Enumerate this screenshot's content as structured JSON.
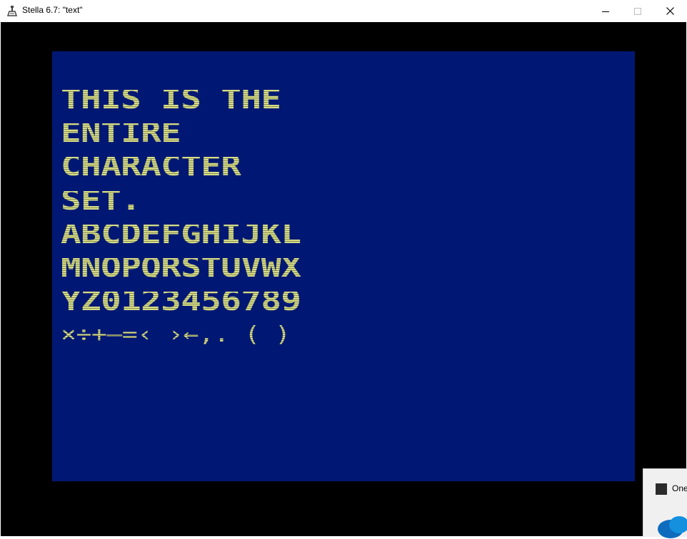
{
  "window": {
    "title": "Stella 6.7: \"text\"",
    "app_icon": "stella-joystick-icon"
  },
  "screen": {
    "background": "#001874",
    "text_color": "#d6dc88",
    "lines": [
      "THIS IS THE",
      "ENTIRE",
      "CHARACTER",
      "SET.",
      "ABCDEFGHIJKL",
      "MNOPQRSTUVWX",
      "YZ0123456789",
      "×÷+—=‹ ›←,. ( )"
    ]
  },
  "notification": {
    "label": "One",
    "icon": "onedrive-cloud-icon"
  }
}
